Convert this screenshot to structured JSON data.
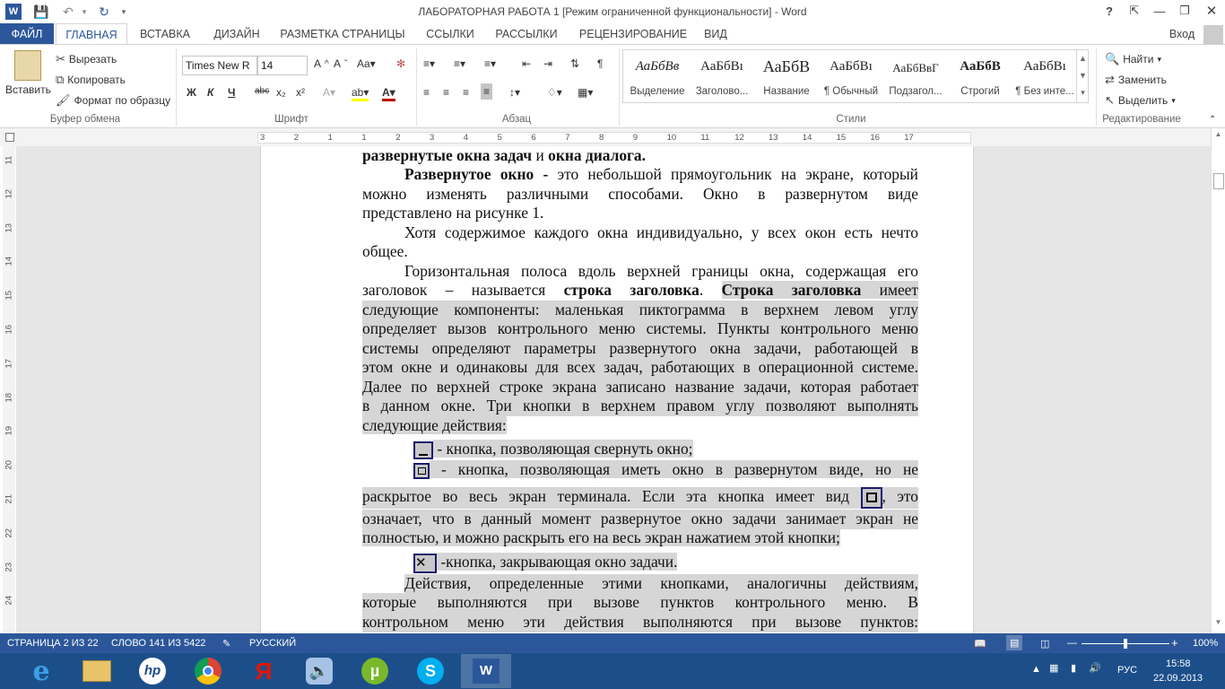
{
  "window": {
    "title": "ЛАБОРАТОРНАЯ РАБОТА 1 [Режим ограниченной функциональности] - Word",
    "help": "?",
    "signin": "Вход"
  },
  "tabs": [
    "ФАЙЛ",
    "ГЛАВНАЯ",
    "ВСТАВКА",
    "ДИЗАЙН",
    "РАЗМЕТКА СТРАНИЦЫ",
    "ССЫЛКИ",
    "РАССЫЛКИ",
    "РЕЦЕНЗИРОВАНИЕ",
    "ВИД"
  ],
  "ribbon": {
    "clipboard": {
      "paste": "Вставить",
      "cut": "Вырезать",
      "copy": "Копировать",
      "format_painter": "Формат по образцу",
      "label": "Буфер обмена"
    },
    "font": {
      "name": "Times New R",
      "size": "14",
      "label": "Шрифт",
      "bold": "Ж",
      "italic": "К",
      "underline": "Ч",
      "strike": "abc",
      "sub": "x₂",
      "sup": "x²"
    },
    "paragraph": {
      "label": "Абзац"
    },
    "styles": {
      "label": "Стили",
      "items": [
        {
          "sample": "АаБбВв",
          "name": "Выделение"
        },
        {
          "sample": "АаБбВı",
          "name": "Заголово..."
        },
        {
          "sample": "АаБбВ",
          "name": "Название"
        },
        {
          "sample": "АаБбВı",
          "name": "¶ Обычный"
        },
        {
          "sample": "АаБбВвГ",
          "name": "Подзагол..."
        },
        {
          "sample": "АаБбВ",
          "name": "Строгий"
        },
        {
          "sample": "АаБбВı",
          "name": "¶ Без инте..."
        }
      ]
    },
    "editing": {
      "find": "Найти",
      "replace": "Заменить",
      "select": "Выделить",
      "label": "Редактирование"
    }
  },
  "ruler": {
    "h": [
      "3",
      "2",
      "1",
      "1",
      "2",
      "3",
      "4",
      "5",
      "6",
      "7",
      "8",
      "9",
      "10",
      "11",
      "12",
      "13",
      "14",
      "15",
      "16",
      "17"
    ],
    "v": [
      "11",
      "12",
      "13",
      "14",
      "15",
      "16",
      "17",
      "18",
      "19",
      "20",
      "21",
      "22",
      "23",
      "24"
    ]
  },
  "doc": {
    "line1_b1": "развернутые окна задач",
    "line1_n": " и ",
    "line1_b2": "окна диалога.",
    "p2_b": "Развернутое окно -",
    "p2_a": " это небольшой прямоугольник на экране, который",
    "p2_l2": "можно изменять различными способами. Окно в развернутом виде",
    "p2_l3": "представлено на рисунке 1.",
    "p3_l1": "Хотя содержимое каждого окна индивидуально, у всех окон есть нечто",
    "p3_l2": "общее.",
    "p4_l1": "Горизонтальная полоса вдоль верхней границы окна, содержащая его",
    "p4_l2a": "заголовок – называется ",
    "p4_l2b": "строка заголовка",
    "p4_l2c": ". ",
    "p4_l2d": "Строка заголовка",
    "p4_l2e": " имеет",
    "p4_l3": "следующие компоненты: маленькая пиктограмма в верхнем левом углу",
    "p4_l4": "определяет вызов контрольного меню системы. Пункты контрольного меню",
    "p4_l5": "системы определяют параметры развернутого окна задачи, работающей в",
    "p4_l6": "этом окне и одинаковы для всех задач, работающих в операционной системе.",
    "p4_l7": "Далее по верхней строке экрана записано название задачи, которая работает",
    "p4_l8": "в данном окне. Три кнопки в верхнем правом углу позволяют выполнять",
    "p4_l9": "следующие действия:",
    "b1": " - кнопка, позволяющая свернуть окно;",
    "b2_l1": " - кнопка, позволяющая иметь окно в развернутом виде, но не",
    "b2_l2a": "раскрытое во весь экран терминала. Если эта кнопка имеет вид ",
    "b2_l2b": ", это",
    "b2_l3": "означает, что в данный момент развернутое окно задачи занимает экран не",
    "b2_l4": "полностью, и можно раскрыть его на весь экран нажатием этой кнопки;",
    "b3": " -кнопка, закрывающая окно задачи.",
    "p5_l1": "Действия, определенные этими кнопками, аналогичны действиям,",
    "p5_l2": "которые выполняются при вызове пунктов контрольного меню. В",
    "p5_l3": "контрольном меню эти действия выполняются при вызове пунктов:"
  },
  "status": {
    "page": "СТРАНИЦА 2 ИЗ 22",
    "words": "СЛОВО 141 ИЗ 5422",
    "lang": "РУССКИЙ",
    "zoom": "100%",
    "zoom_value": 100
  },
  "taskbar": {
    "lang": "РУС",
    "time": "15:58",
    "date": "22.09.2013"
  },
  "colors": {
    "accent": "#2b579a",
    "highlight": "#d6d6d6",
    "taskbar": "#1c4f8a"
  }
}
